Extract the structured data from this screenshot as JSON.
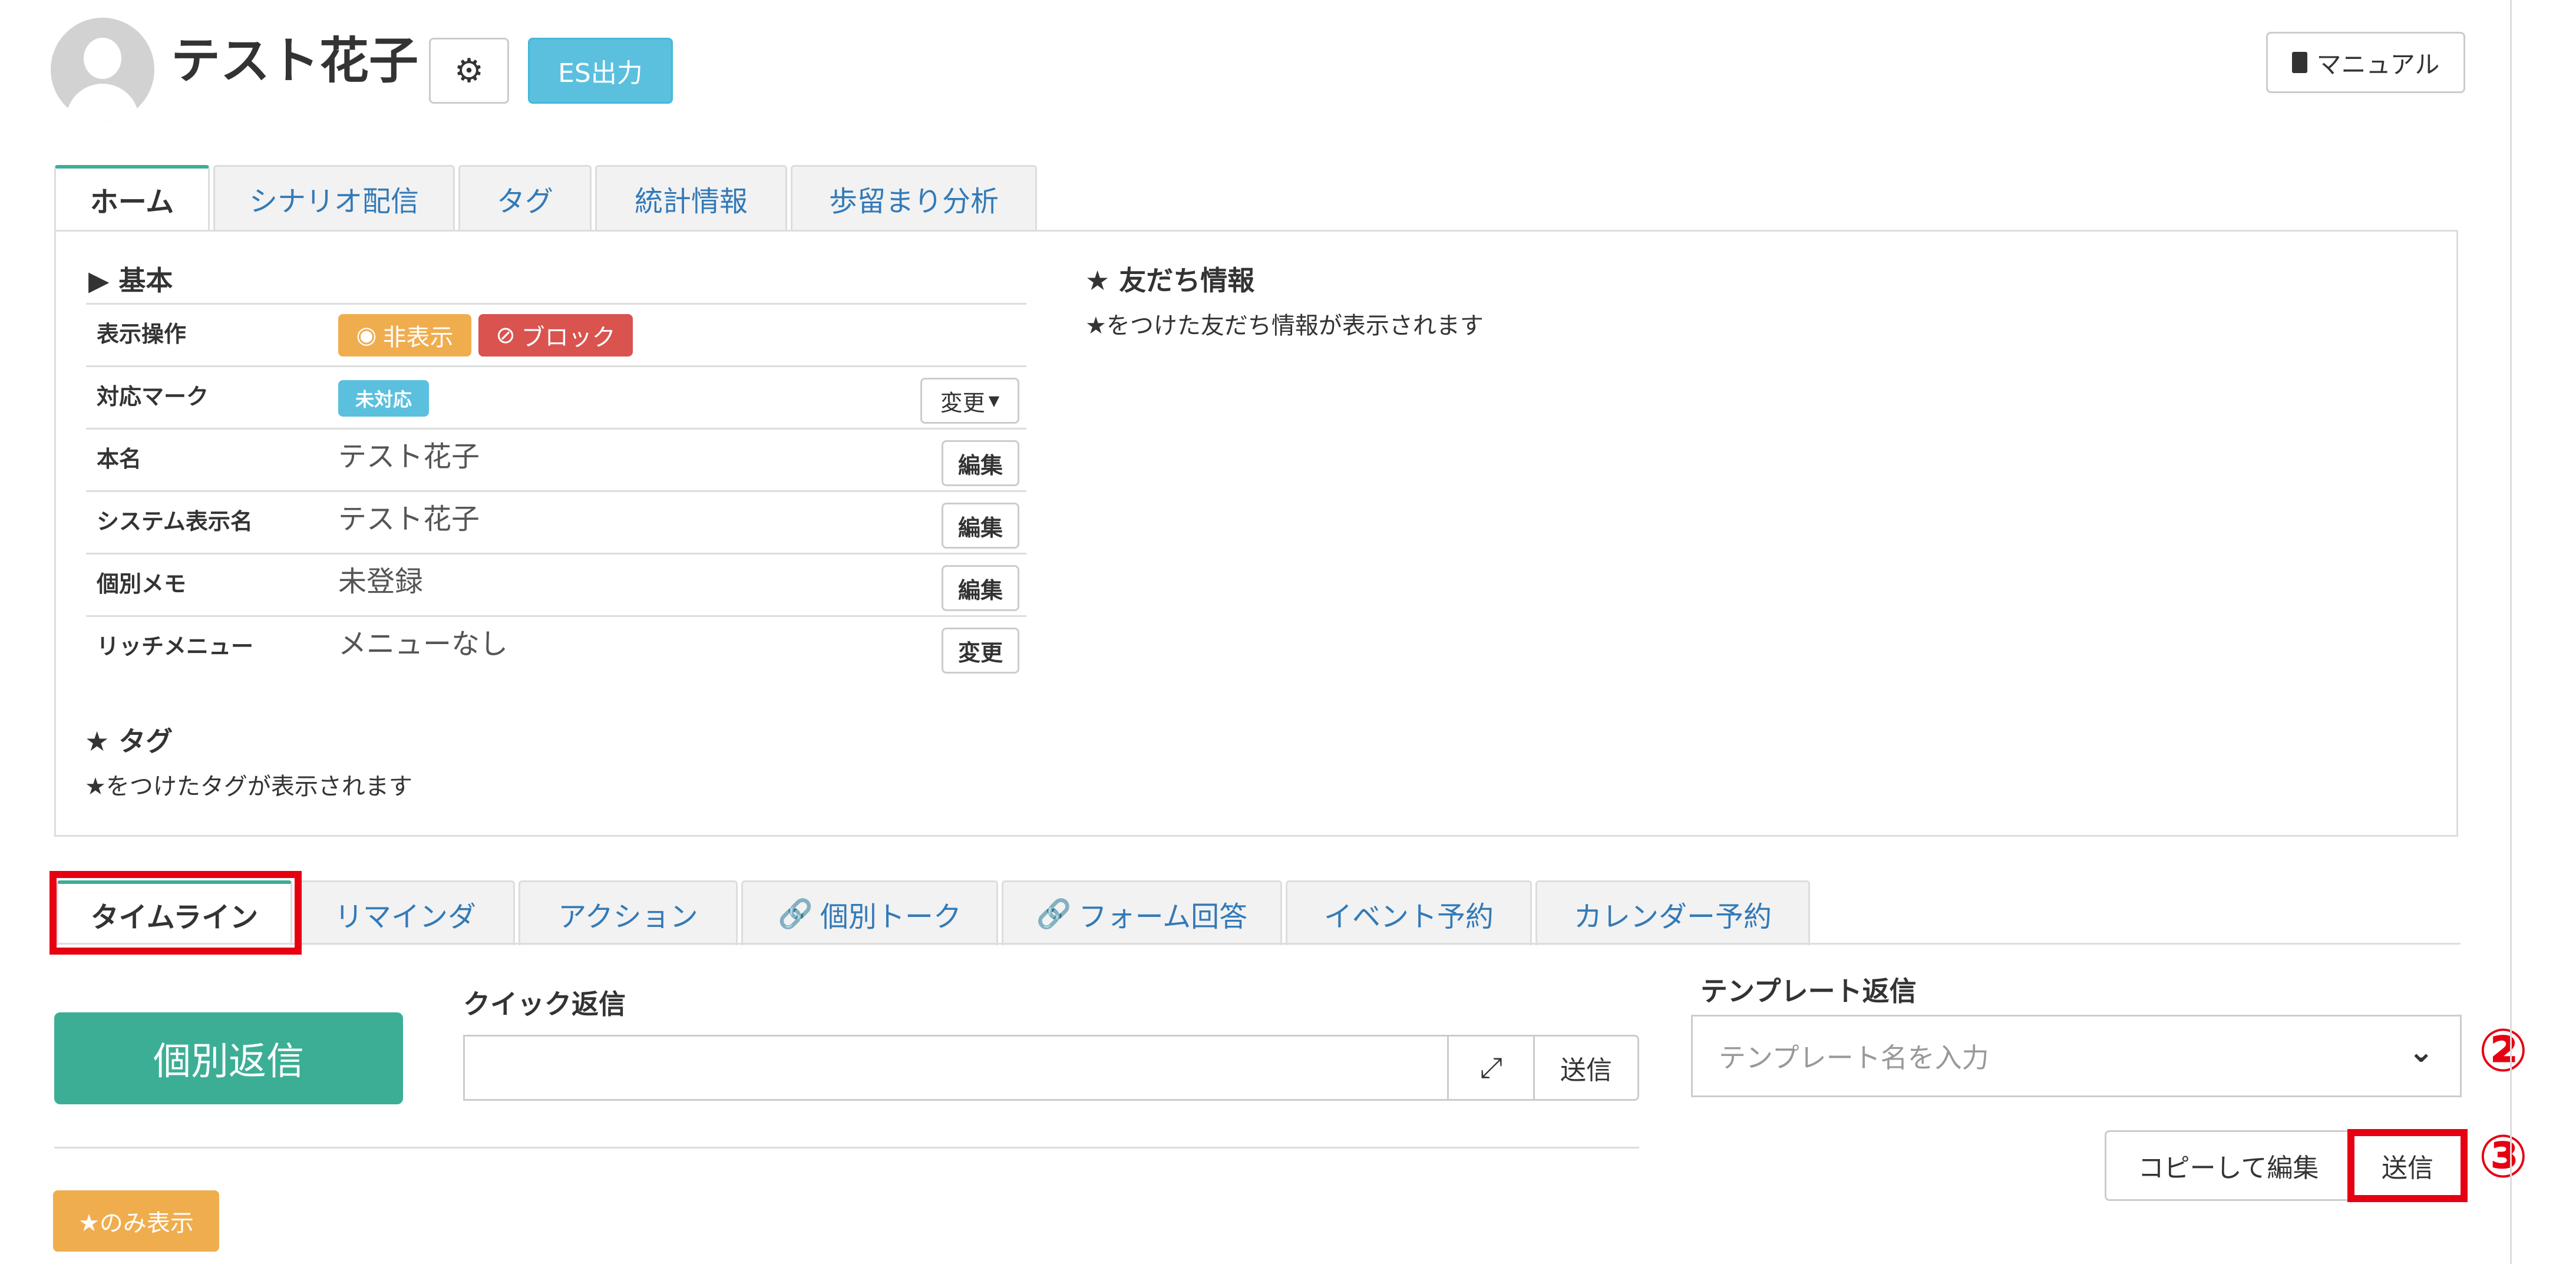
{
  "header": {
    "title": "テスト花子",
    "gear_icon": "gear-icon",
    "es_label": "ES出力",
    "manual_label": "マニュアル"
  },
  "top_tabs": [
    {
      "label": "ホーム",
      "active": true
    },
    {
      "label": "シナリオ配信",
      "active": false
    },
    {
      "label": "タグ",
      "active": false
    },
    {
      "label": "統計情報",
      "active": false
    },
    {
      "label": "歩留まり分析",
      "active": false
    }
  ],
  "basic": {
    "title": "▶ 基本",
    "rows": {
      "display": {
        "label": "表示操作",
        "hide": "非表示",
        "block": "ブロック"
      },
      "mark": {
        "label": "対応マーク",
        "badge": "未対応",
        "action": "変更"
      },
      "name": {
        "label": "本名",
        "value": "テスト花子",
        "action": "編集"
      },
      "sysname": {
        "label": "システム表示名",
        "value": "テスト花子",
        "action": "編集"
      },
      "memo": {
        "label": "個別メモ",
        "value": "未登録",
        "action": "編集"
      },
      "richmenu": {
        "label": "リッチメニュー",
        "value": "メニューなし",
        "action": "変更"
      }
    }
  },
  "tag_section": {
    "title": "★ タグ",
    "desc": "★をつけたタグが表示されます"
  },
  "friend_section": {
    "title": "★ 友だち情報",
    "desc": "★をつけた友だち情報が表示されます"
  },
  "bottom_tabs": [
    {
      "label": "タイムライン",
      "active": true,
      "icon": ""
    },
    {
      "label": "リマインダ",
      "active": false,
      "icon": ""
    },
    {
      "label": "アクション",
      "active": false,
      "icon": ""
    },
    {
      "label": "個別トーク",
      "active": false,
      "icon": "link-icon"
    },
    {
      "label": "フォーム回答",
      "active": false,
      "icon": "link-icon"
    },
    {
      "label": "イベント予約",
      "active": false,
      "icon": ""
    },
    {
      "label": "カレンダー予約",
      "active": false,
      "icon": ""
    }
  ],
  "reply": {
    "individual_label": "個別返信",
    "quick_title": "クイック返信",
    "quick_value": "",
    "quick_send": "送信",
    "template_title": "テンプレート返信",
    "template_placeholder": "テンプレート名を入力",
    "copy_edit": "コピーして編集",
    "template_send": "送信",
    "star_only": "★のみ表示"
  },
  "annotations": {
    "two": "②",
    "three": "③"
  },
  "colors": {
    "accent": "#3cae95",
    "info": "#5bc0de",
    "warning": "#f0ad4e",
    "danger": "#d9534f",
    "highlight": "#e60012",
    "link": "#337ab7"
  }
}
